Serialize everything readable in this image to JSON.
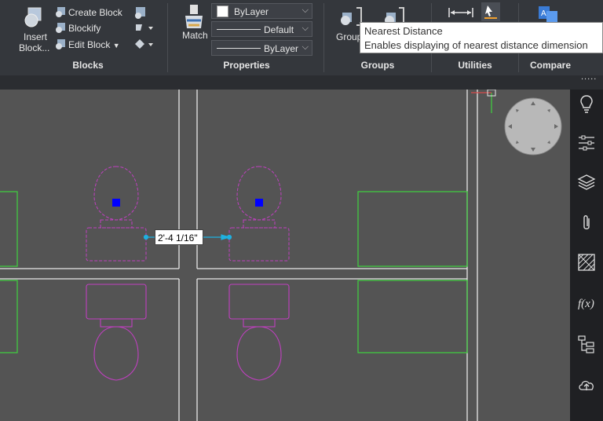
{
  "ribbon": {
    "blocks": {
      "title": "Blocks",
      "insert_label_1": "Insert",
      "insert_label_2": "Block...",
      "create_block": "Create Block",
      "blockify": "Blockify",
      "edit_block": "Edit Block"
    },
    "properties": {
      "title": "Properties",
      "match_label": "Match",
      "color_value": "ByLayer",
      "lineweight_value": "Default",
      "linetype_value": "ByLayer"
    },
    "groups": {
      "title": "Groups",
      "group_label": "Group"
    },
    "utilities": {
      "title": "Utilities"
    },
    "compare": {
      "title": "Compare"
    },
    "more": "....."
  },
  "tooltip": {
    "title": "Nearest Distance",
    "description": "Enables displaying of nearest distance dimension"
  },
  "canvas": {
    "dimension_value": "2'-4 1/16\"",
    "colors": {
      "background": "#545454",
      "walls": "#e8e8e8",
      "fixtures": "#c040c0",
      "counters": "#3fd33f",
      "grip": "#0000ff",
      "dimension": "#1fb0e0"
    }
  },
  "sidebar": {
    "icons": [
      "lightbulb-icon",
      "sliders-icon",
      "layers-icon",
      "paperclip-icon",
      "hatch-icon",
      "function-icon",
      "tree-icon",
      "cloud-icon"
    ]
  }
}
